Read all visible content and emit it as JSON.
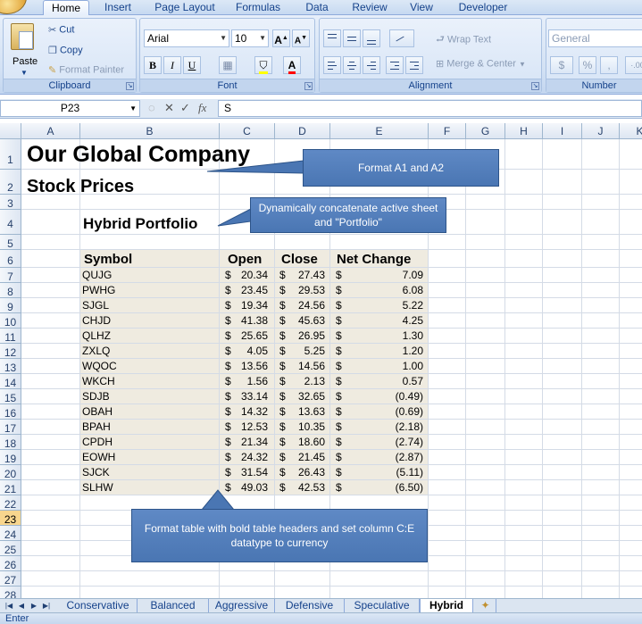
{
  "ribbon": {
    "tabs": [
      "Home",
      "Insert",
      "Page Layout",
      "Formulas",
      "Data",
      "Review",
      "View",
      "Developer"
    ],
    "active_tab": "Home",
    "clipboard": {
      "label": "Clipboard",
      "paste": "Paste",
      "cut": "Cut",
      "copy": "Copy",
      "format_painter": "Format Painter"
    },
    "font": {
      "label": "Font",
      "name": "Arial",
      "size": "10"
    },
    "alignment": {
      "label": "Alignment",
      "wrap_text": "Wrap Text",
      "merge_center": "Merge & Center"
    },
    "number": {
      "label": "Number",
      "format": "General",
      "currency": "$",
      "percent": "%",
      "comma": ",",
      "decimals": "·.00"
    }
  },
  "formula_bar": {
    "name_box": "P23",
    "fx": "fx",
    "content": "S"
  },
  "columns": [
    "A",
    "B",
    "C",
    "D",
    "E",
    "F",
    "G",
    "H",
    "I",
    "J",
    "K"
  ],
  "rows": [
    "1",
    "2",
    "3",
    "4",
    "5",
    "6",
    "7",
    "8",
    "9",
    "10",
    "11",
    "12",
    "13",
    "14",
    "15",
    "16",
    "17",
    "18",
    "19",
    "20",
    "21",
    "22",
    "23",
    "24",
    "25",
    "26",
    "27",
    "28"
  ],
  "selected_row": "23",
  "sheet": {
    "title": "Our Global Company",
    "subtitle": "Stock Prices",
    "portfolio": "Hybrid Portfolio",
    "headers": {
      "symbol": "Symbol",
      "open": "Open",
      "close": "Close",
      "net": "Net Change"
    },
    "currency_symbol": "$",
    "stocks": [
      {
        "symbol": "QUJG",
        "open": "20.34",
        "close": "27.43",
        "net": "7.09"
      },
      {
        "symbol": "PWHG",
        "open": "23.45",
        "close": "29.53",
        "net": "6.08"
      },
      {
        "symbol": "SJGL",
        "open": "19.34",
        "close": "24.56",
        "net": "5.22"
      },
      {
        "symbol": "CHJD",
        "open": "41.38",
        "close": "45.63",
        "net": "4.25"
      },
      {
        "symbol": "QLHZ",
        "open": "25.65",
        "close": "26.95",
        "net": "1.30"
      },
      {
        "symbol": "ZXLQ",
        "open": "4.05",
        "close": "5.25",
        "net": "1.20"
      },
      {
        "symbol": "WQOC",
        "open": "13.56",
        "close": "14.56",
        "net": "1.00"
      },
      {
        "symbol": "WKCH",
        "open": "1.56",
        "close": "2.13",
        "net": "0.57"
      },
      {
        "symbol": "SDJB",
        "open": "33.14",
        "close": "32.65",
        "net": "(0.49)"
      },
      {
        "symbol": "OBAH",
        "open": "14.32",
        "close": "13.63",
        "net": "(0.69)"
      },
      {
        "symbol": "BPAH",
        "open": "12.53",
        "close": "10.35",
        "net": "(2.18)"
      },
      {
        "symbol": "CPDH",
        "open": "21.34",
        "close": "18.60",
        "net": "(2.74)"
      },
      {
        "symbol": "EOWH",
        "open": "24.32",
        "close": "21.45",
        "net": "(2.87)"
      },
      {
        "symbol": "SJCK",
        "open": "31.54",
        "close": "26.43",
        "net": "(5.11)"
      },
      {
        "symbol": "SLHW",
        "open": "49.03",
        "close": "42.53",
        "net": "(6.50)"
      }
    ]
  },
  "callouts": {
    "format_titles": "Format A1 and A2",
    "concatenate": "Dynamically concatenate active sheet and \"Portfolio\"",
    "format_table": "Format table with bold table headers and set column C:E datatype to currency"
  },
  "sheet_tabs": [
    "Conservative",
    "Balanced",
    "Aggressive",
    "Defensive",
    "Speculative",
    "Hybrid"
  ],
  "active_sheet": "Hybrid",
  "status": "Enter",
  "colors": {
    "accent": "#4a76b3",
    "table_fill": "#efebe0",
    "ribbon": "#d2e1f4",
    "selected_row": "#f8d68e"
  }
}
